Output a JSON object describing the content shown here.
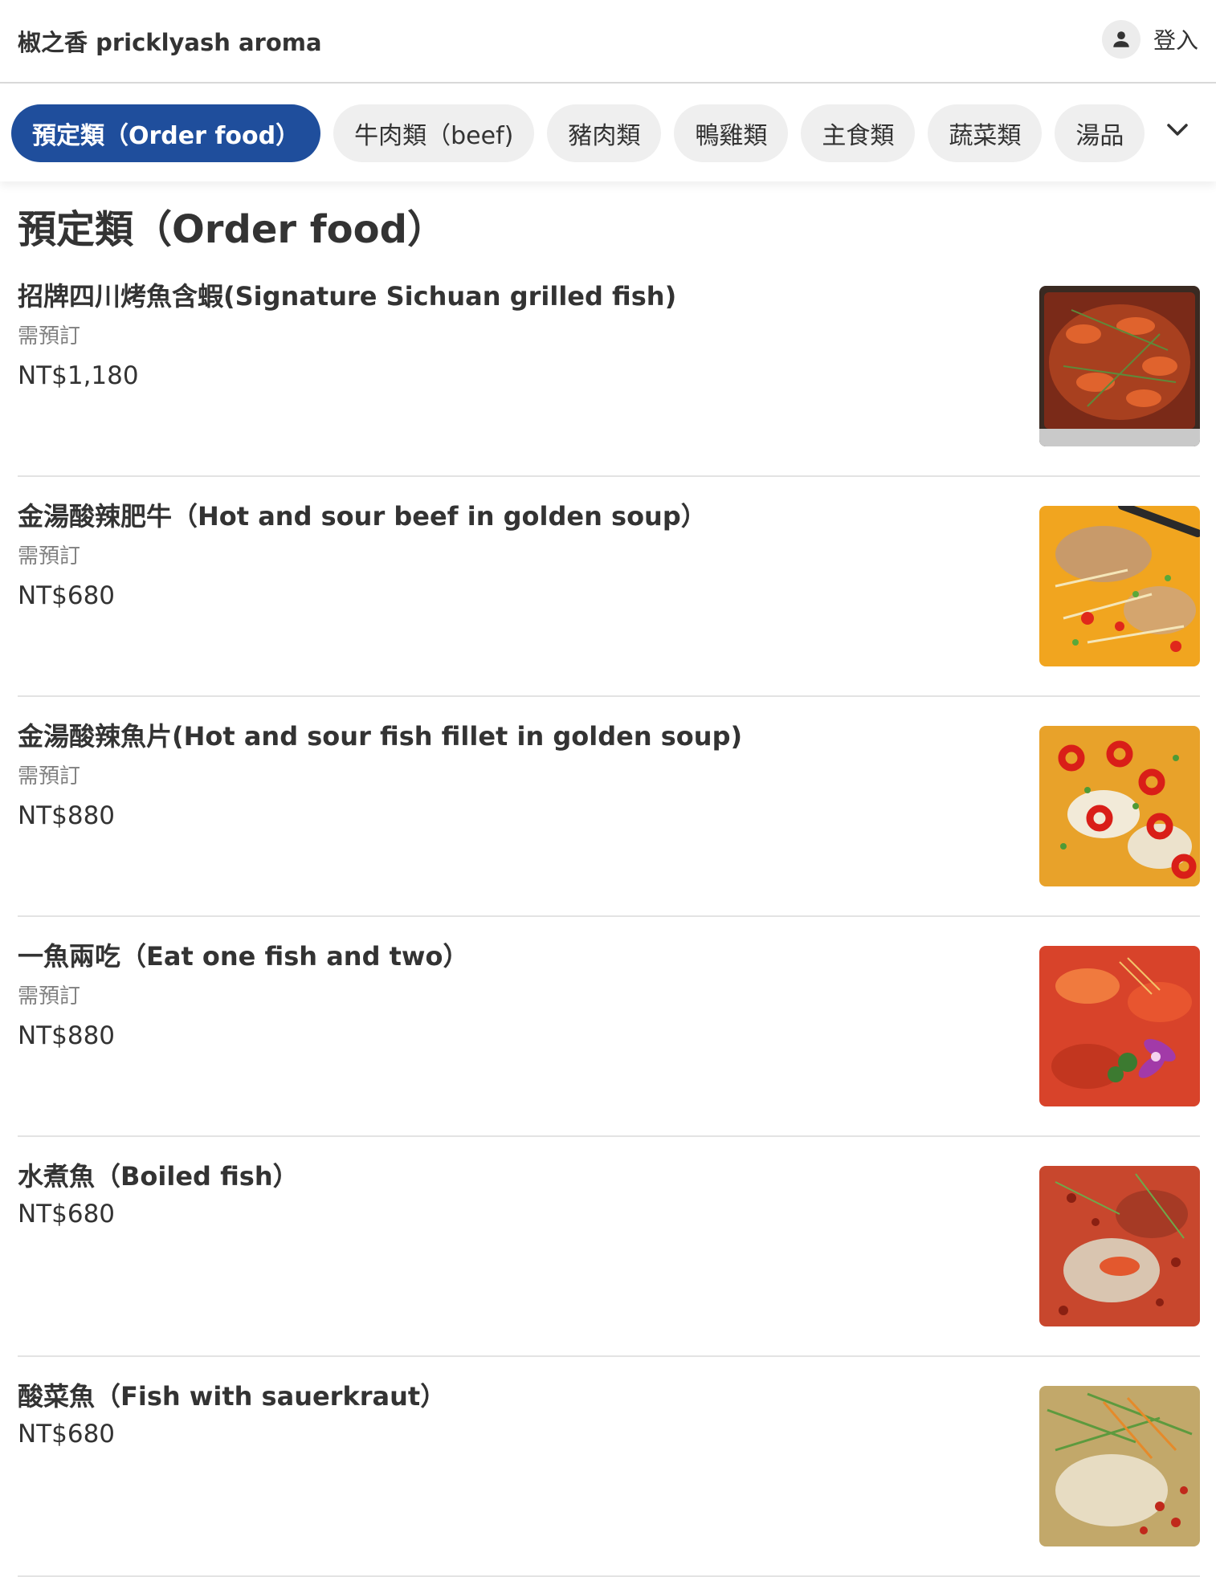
{
  "header": {
    "store_name": "椒之香 pricklyash aroma",
    "login_label": "登入",
    "user_icon": "user-icon"
  },
  "categories": [
    {
      "label": "預定類（Order food）",
      "active": true
    },
    {
      "label": "牛肉類（beef)",
      "active": false
    },
    {
      "label": "豬肉類",
      "active": false
    },
    {
      "label": "鴨雞類",
      "active": false
    },
    {
      "label": "主食類",
      "active": false
    },
    {
      "label": "蔬菜類",
      "active": false
    },
    {
      "label": "湯品",
      "active": false
    }
  ],
  "expand_icon": "chevron-down-icon",
  "section": {
    "title": "預定類（Order food）"
  },
  "items": [
    {
      "name": "招牌四川烤魚含蝦(Signature Sichuan grilled fish)",
      "note": "需預訂",
      "price": "NT$1,180",
      "photo_icon": "grilled-fish-photo"
    },
    {
      "name": "金湯酸辣肥牛（Hot and sour beef in golden soup）",
      "note": "需預訂",
      "price": "NT$680",
      "photo_icon": "golden-soup-beef-photo"
    },
    {
      "name": "金湯酸辣魚片(Hot and sour fish fillet in golden soup)",
      "note": "需預訂",
      "price": "NT$880",
      "photo_icon": "golden-soup-fish-photo"
    },
    {
      "name": "一魚兩吃（Eat one fish and two）",
      "note": "需預訂",
      "price": "NT$880",
      "photo_icon": "two-way-fish-photo"
    },
    {
      "name": "水煮魚（Boiled fish）",
      "note": "",
      "price": "NT$680",
      "photo_icon": "boiled-fish-photo"
    },
    {
      "name": "酸菜魚（Fish with sauerkraut）",
      "note": "",
      "price": "NT$680",
      "photo_icon": "sauerkraut-fish-photo"
    }
  ],
  "colors": {
    "accent": "#1f4e9c",
    "chip_bg": "#efefef",
    "muted_text": "#808080",
    "divider": "#e3e3e3"
  }
}
